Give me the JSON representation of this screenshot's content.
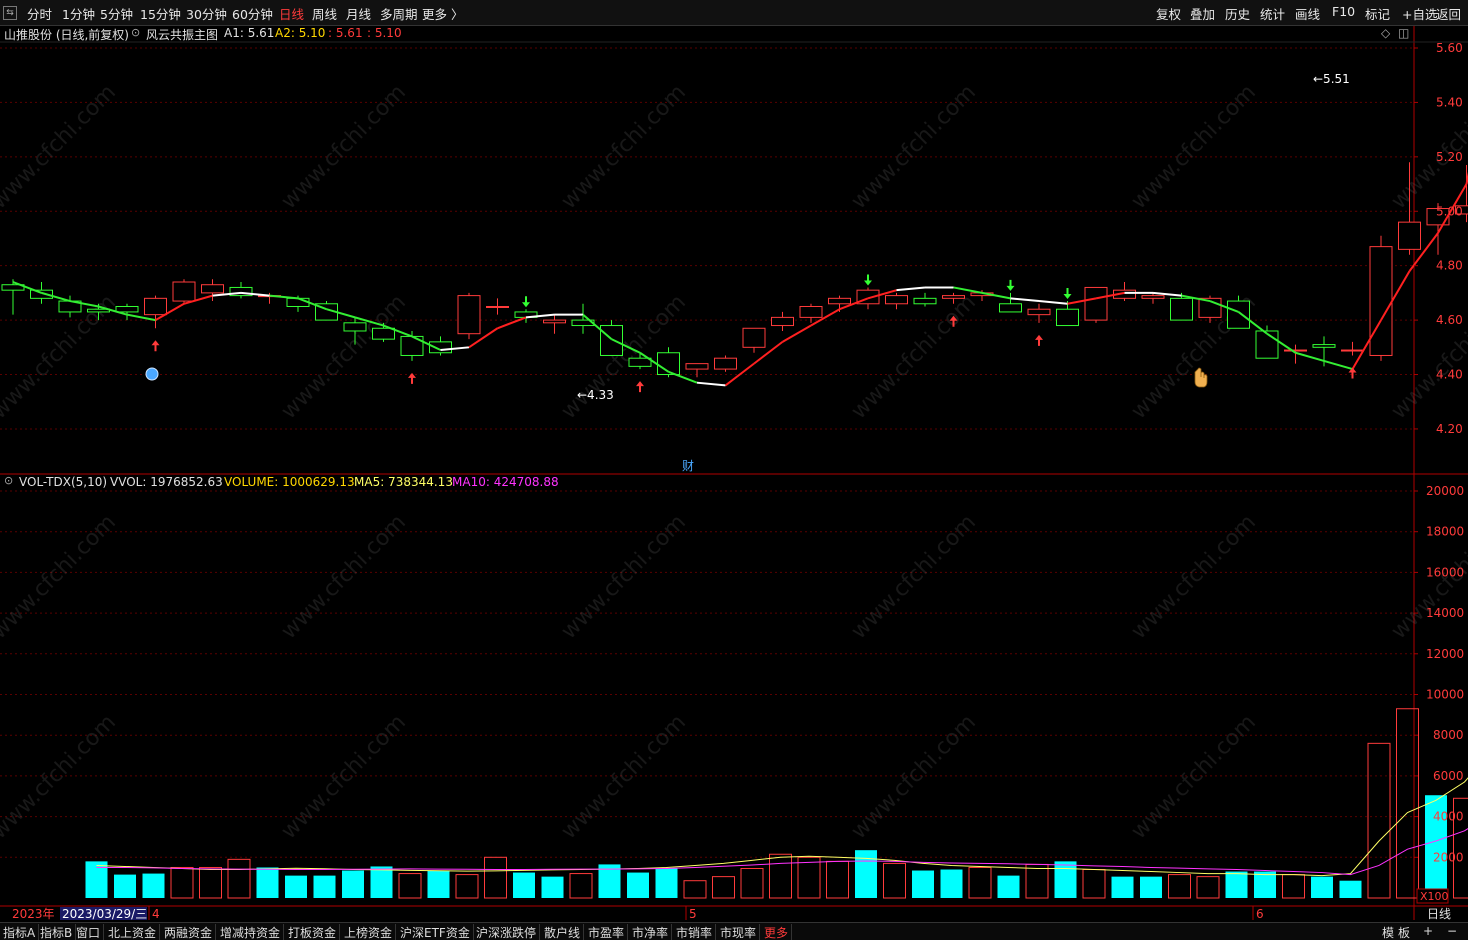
{
  "toolbar": {
    "periods": [
      "分时",
      "1分钟",
      "5分钟",
      "15分钟",
      "30分钟",
      "60分钟",
      "日线",
      "周线",
      "月线",
      "多周期",
      "更多 〉"
    ],
    "active_period": "日线",
    "right_tools": [
      "复权",
      "叠加",
      "历史",
      "统计",
      "画线",
      "F10",
      "标记",
      "+自选",
      "返回"
    ]
  },
  "price_header": {
    "stock": "山推股份 (日线,前复权)",
    "indicator": "风云共振主图",
    "a1_label": "A1: 5.61",
    "a2_label": "A2: 5.10",
    "v1": ": 5.61",
    "v2": ": 5.10"
  },
  "volume_header": {
    "name": "VOL-TDX(5,10)",
    "vvol": "VVOL: 1976852.63",
    "volume": "VOLUME: 1000629.13",
    "ma5": "MA5: 738344.13",
    "ma10": "MA10: 424708.88"
  },
  "price_axis": {
    "labels": [
      "5.60",
      "5.40",
      "5.20",
      "5.00",
      "4.80",
      "4.60",
      "4.40",
      "4.20"
    ]
  },
  "volume_axis": {
    "labels": [
      "20000",
      "18000",
      "16000",
      "14000",
      "12000",
      "10000",
      "8000",
      "6000",
      "4000",
      "2000"
    ],
    "unit": "X100"
  },
  "date_axis": {
    "year": "2023年",
    "cursor_date": "2023/03/29/三",
    "months": [
      "4",
      "5",
      "6"
    ],
    "period_label": "日线"
  },
  "annotations": {
    "low_label": "4.33",
    "high_label": "5.51",
    "fin_marker": "财"
  },
  "bottom_tabs": [
    "指标A",
    "指标B",
    "窗口",
    "北上资金",
    "两融资金",
    "增减持资金",
    "打板资金",
    "上榜资金",
    "沪深ETF资金",
    "沪深涨跌停",
    "散户线",
    "市盈率",
    "市净率",
    "市销率",
    "市现率",
    "更多"
  ],
  "bottom_right": [
    "模",
    "板",
    "+",
    "−"
  ],
  "watermark": "www.cfchi.com",
  "colors": {
    "up": "#ff3b3b",
    "down": "#00ffff",
    "kdown": "#33ff33",
    "line_red": "#ff2020",
    "line_green": "#33ee33",
    "vol_ma5": "#ffff66",
    "vol_ma10": "#ff33ff",
    "grid": "#5a0000",
    "axis": "#b00000"
  },
  "chart_data": [
    {
      "type": "candlestick",
      "title": "山推股份 (日线,前复权)",
      "ylim": [
        4.15,
        5.65
      ],
      "ohlc": [
        [
          4.73,
          4.75,
          4.62,
          4.71
        ],
        [
          4.71,
          4.74,
          4.66,
          4.68
        ],
        [
          4.67,
          4.69,
          4.61,
          4.63
        ],
        [
          4.64,
          4.66,
          4.6,
          4.63
        ],
        [
          4.65,
          4.66,
          4.6,
          4.63
        ],
        [
          4.62,
          4.69,
          4.57,
          4.68
        ],
        [
          4.67,
          4.75,
          4.66,
          4.74
        ],
        [
          4.7,
          4.75,
          4.67,
          4.73
        ],
        [
          4.72,
          4.74,
          4.68,
          4.69
        ],
        [
          4.69,
          4.7,
          4.66,
          4.69
        ],
        [
          4.68,
          4.69,
          4.63,
          4.65
        ],
        [
          4.66,
          4.67,
          4.6,
          4.6
        ],
        [
          4.59,
          4.61,
          4.51,
          4.56
        ],
        [
          4.57,
          4.59,
          4.52,
          4.53
        ],
        [
          4.54,
          4.56,
          4.45,
          4.47
        ],
        [
          4.52,
          4.54,
          4.47,
          4.48
        ],
        [
          4.55,
          4.7,
          4.53,
          4.69
        ],
        [
          4.65,
          4.68,
          4.62,
          4.65
        ],
        [
          4.63,
          4.64,
          4.59,
          4.61
        ],
        [
          4.59,
          4.62,
          4.55,
          4.6
        ],
        [
          4.6,
          4.66,
          4.55,
          4.58
        ],
        [
          4.58,
          4.6,
          4.47,
          4.47
        ],
        [
          4.46,
          4.48,
          4.42,
          4.43
        ],
        [
          4.48,
          4.5,
          4.39,
          4.4
        ],
        [
          4.42,
          4.44,
          4.39,
          4.44
        ],
        [
          4.42,
          4.47,
          4.41,
          4.46
        ],
        [
          4.5,
          4.57,
          4.48,
          4.57
        ],
        [
          4.58,
          4.63,
          4.56,
          4.61
        ],
        [
          4.61,
          4.66,
          4.59,
          4.65
        ],
        [
          4.66,
          4.69,
          4.63,
          4.68
        ],
        [
          4.66,
          4.72,
          4.64,
          4.71
        ],
        [
          4.66,
          4.7,
          4.64,
          4.69
        ],
        [
          4.68,
          4.7,
          4.65,
          4.66
        ],
        [
          4.68,
          4.7,
          4.66,
          4.69
        ],
        [
          4.69,
          4.71,
          4.67,
          4.7
        ],
        [
          4.66,
          4.7,
          4.63,
          4.63
        ],
        [
          4.62,
          4.66,
          4.59,
          4.64
        ],
        [
          4.64,
          4.67,
          4.58,
          4.58
        ],
        [
          4.6,
          4.72,
          4.59,
          4.72
        ],
        [
          4.68,
          4.74,
          4.67,
          4.71
        ],
        [
          4.68,
          4.7,
          4.66,
          4.69
        ],
        [
          4.68,
          4.7,
          4.6,
          4.6
        ],
        [
          4.61,
          4.69,
          4.59,
          4.68
        ],
        [
          4.67,
          4.69,
          4.57,
          4.57
        ],
        [
          4.56,
          4.58,
          4.46,
          4.46
        ],
        [
          4.49,
          4.51,
          4.44,
          4.49
        ],
        [
          4.51,
          4.54,
          4.43,
          4.5
        ],
        [
          4.49,
          4.52,
          4.47,
          4.49
        ],
        [
          4.47,
          4.91,
          4.45,
          4.87
        ],
        [
          4.86,
          5.18,
          4.84,
          4.96
        ],
        [
          4.95,
          5.03,
          4.84,
          5.01
        ],
        [
          4.99,
          5.17,
          4.96,
          5.02
        ],
        [
          5.03,
          5.6,
          5.02,
          5.51
        ]
      ]
    },
    {
      "type": "bar",
      "title": "VOL-TDX(5,10)",
      "ylim": [
        0,
        20000
      ],
      "values": [
        1800,
        1150,
        1200,
        1500,
        1500,
        1900,
        1500,
        1100,
        1100,
        1350,
        1550,
        1200,
        1350,
        1150,
        2000,
        1250,
        1050,
        1200,
        1650,
        1250,
        1450,
        850,
        1050,
        1450,
        2150,
        2000,
        1800,
        2350,
        1700,
        1350,
        1400,
        1500,
        1100,
        1650,
        1800,
        1400,
        1050,
        1050,
        1150,
        1050,
        1300,
        1300,
        1150,
        1050,
        850,
        7600,
        9300,
        5050,
        4900,
        10000
      ],
      "ghost": [
        0,
        0,
        0,
        0,
        0,
        0,
        0,
        0,
        0,
        0,
        0,
        0,
        0,
        0,
        0,
        0,
        0,
        0,
        0,
        0,
        0,
        0,
        0,
        0,
        0,
        0,
        0,
        0,
        0,
        0,
        0,
        0,
        0,
        0,
        0,
        0,
        0,
        0,
        0,
        0,
        0,
        0,
        0,
        0,
        0,
        0,
        0,
        0,
        0,
        19770
      ],
      "up": [
        false,
        false,
        false,
        true,
        true,
        true,
        false,
        false,
        false,
        false,
        false,
        true,
        false,
        true,
        true,
        false,
        false,
        true,
        false,
        false,
        false,
        true,
        true,
        true,
        true,
        true,
        true,
        false,
        true,
        false,
        false,
        true,
        false,
        true,
        false,
        true,
        false,
        false,
        true,
        true,
        false,
        false,
        true,
        false,
        false,
        true,
        true,
        false,
        true,
        true
      ],
      "series": [
        {
          "name": "MA5",
          "values": [
            1600,
            1550,
            1500,
            1450,
            1400,
            1400,
            1430,
            1460,
            1440,
            1400,
            1380,
            1360,
            1340,
            1320,
            1330,
            1360,
            1380,
            1400,
            1420,
            1450,
            1500,
            1600,
            1700,
            1850,
            2000,
            2050,
            2000,
            1950,
            1850,
            1700,
            1600,
            1550,
            1500,
            1450,
            1450,
            1400,
            1350,
            1300,
            1250,
            1200,
            1200,
            1150,
            1150,
            1100,
            1200,
            2800,
            4200,
            4800,
            5700,
            7300
          ]
        },
        {
          "name": "MA10",
          "values": [
            1500,
            1500,
            1480,
            1450,
            1430,
            1420,
            1410,
            1400,
            1400,
            1410,
            1420,
            1430,
            1420,
            1410,
            1400,
            1400,
            1410,
            1420,
            1420,
            1430,
            1450,
            1500,
            1560,
            1620,
            1700,
            1750,
            1800,
            1820,
            1800,
            1750,
            1720,
            1700,
            1680,
            1650,
            1620,
            1580,
            1550,
            1500,
            1470,
            1430,
            1400,
            1350,
            1300,
            1250,
            1150,
            1600,
            2400,
            2800,
            3300,
            4200
          ]
        }
      ]
    }
  ]
}
